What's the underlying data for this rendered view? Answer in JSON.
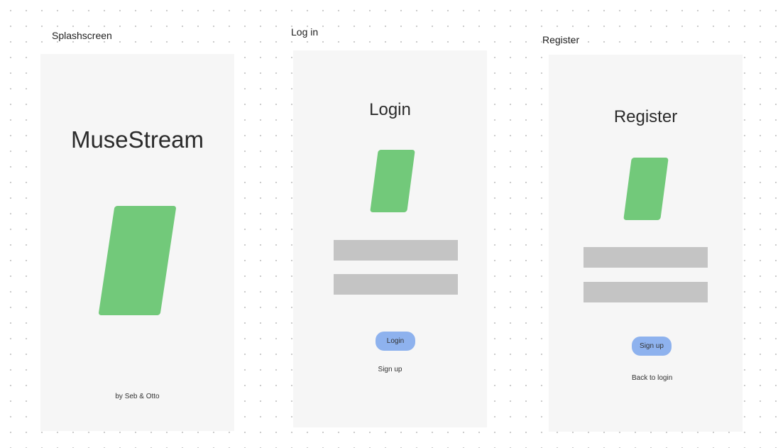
{
  "frames": {
    "splash": {
      "label": "Splashscreen",
      "app_name": "MuseStream",
      "credit": "by Seb & Otto"
    },
    "login": {
      "label": "Log in",
      "title": "Login",
      "button_label": "Login",
      "alt_link": "Sign up"
    },
    "register": {
      "label": "Register",
      "title": "Register",
      "button_label": "Sign up",
      "alt_link": "Back to login"
    }
  },
  "colors": {
    "canvas": "#ffffff",
    "frame_bg": "#f6f6f6",
    "logo_green": "#72c97a",
    "field_gray": "#c4c4c4",
    "button_blue": "#8eb2ee"
  }
}
